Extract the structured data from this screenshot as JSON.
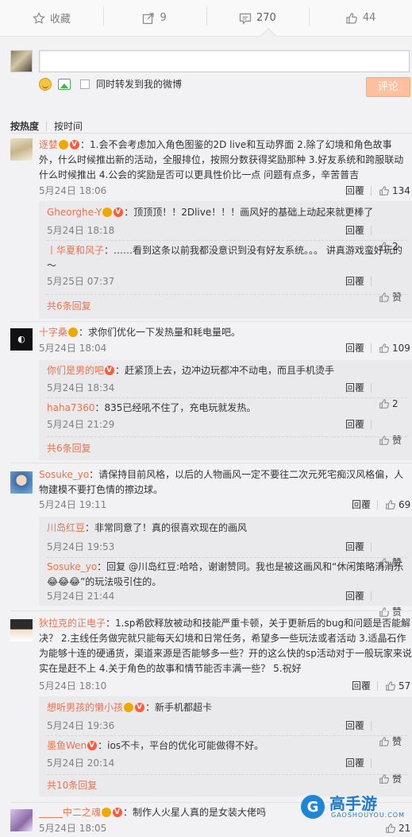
{
  "actions": {
    "favorite": "收藏",
    "forward": "9",
    "comment": "270",
    "like": "44"
  },
  "composer": {
    "forward_also": "同时转发到我的微博",
    "submit": "评论"
  },
  "sort": {
    "hot": "按热度",
    "time": "按时间"
  },
  "labels": {
    "reply": "回覆",
    "like_plain": "赞"
  },
  "comments": [
    {
      "user": "逐婪",
      "text": "：1.会不会考虑加入角色图鉴的2D live和互动界面 2.除了幻境和角色故事外，什么时候推出新的活动，全服排位，按照分数获得奖励那种 3.好友系统和跨服联动什么时候推出 4.公会的奖励是否可以更具性价比一点 问题有点多，辛苦普吉",
      "date": "5月24日 18:06",
      "likes": "134",
      "subs": [
        {
          "user": "Gheorghe-Y",
          "text": "：顶顶顶！！2Dlive！！！画风好的基础上动起来就更棒了",
          "date": "5月24日 18:18",
          "likes": "2"
        },
        {
          "user": "丨华夏和风子",
          "text": "：……看到这条以前我都没意识到没有好友系统。。。 讲真游戏蛮好玩的～",
          "date": "5月25日 07:37",
          "likes": "赞"
        }
      ],
      "more": "共6条回复"
    },
    {
      "user": "十字桑",
      "text": "：求你们优化一下发热量和耗电量吧。",
      "date": "5月24日 18:04",
      "likes": "109",
      "subs": [
        {
          "user": "你们是男的吧",
          "text": "：赶紧顶上去，边冲边玩都冲不动电，而且手机烫手",
          "date": "5月24日 18:34",
          "likes": "2"
        },
        {
          "user": "haha7360",
          "text": "：835已经吼不住了，充电玩就发热。",
          "date": "5月24日 21:29",
          "likes": "赞"
        }
      ],
      "more": "共6条回复"
    },
    {
      "user": "Sosuke_yo",
      "text": "：请保持目前风格，以后的人物画风一定不要往二次元死宅痴汉风格偏，人物建模不要打色情的擦边球。",
      "date": "5月24日 19:11",
      "likes": "69",
      "subs": [
        {
          "user": "川岛红豆",
          "text": "：非常同意了！真的很喜欢现在的画风",
          "date": "5月24日 19:53",
          "likes": "赞"
        },
        {
          "user": "Sosuke_yo",
          "text": "：回复 @川岛红豆:哈哈，谢谢赞同。我也是被这画风和“休闲策略消消乐😂😂😂”的玩法吸引住的。",
          "date": "5月24日 21:44",
          "likes": "赞"
        }
      ]
    },
    {
      "user": "狄拉克的正电子",
      "text": "：1.sp希欧释放被动和技能严重卡顿，关于更新后的bug和问题是否能解决？ 2.主线任务做完就只能每天幻境和日常任务，希望多一些玩法或者活动 3.适晶石作为能够十连的硬通货，渠道来源是否能够多一些？开的这么快的sp活动对于一般玩家来说实在是赶不上 4.关于角色的故事和情节能否丰满一些？ 5.祝好",
      "date": "5月24日 18:10",
      "likes": "57",
      "subs": [
        {
          "user": "想听男孩的懒小孩",
          "text": "：新手机都超卡",
          "date": "5月24日 19:36",
          "likes": "赞"
        },
        {
          "user": "墨鱼Wen",
          "text": "：ios不卡，平台的优化可能做得不好。",
          "date": "5月24日 20:14",
          "likes": "赞"
        }
      ],
      "more": "共10条回复"
    },
    {
      "user": "_____中二之魂",
      "text": "：制作人火星人真的是女装大佬吗",
      "date": "5月24日 18:05",
      "likes": "21"
    }
  ],
  "watermark": {
    "brand": "高手游",
    "url": "GAOSHOUYOU.COM"
  }
}
